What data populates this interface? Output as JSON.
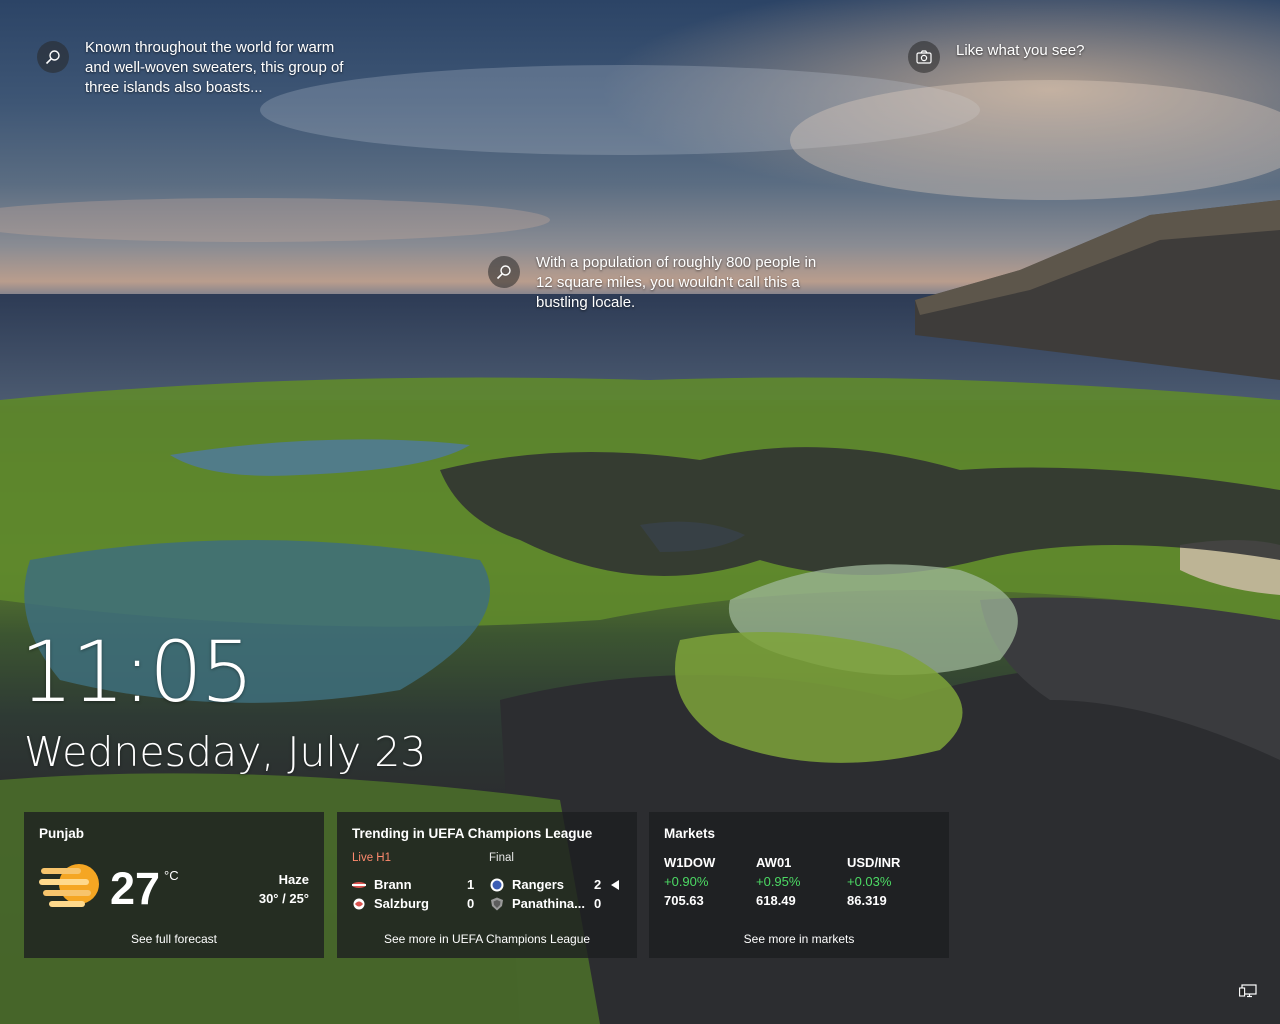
{
  "hotspots": {
    "top_left": "Known throughout the world for warm and well-woven sweaters, this group of three islands also boasts...",
    "middle": "With a population of roughly 800 people in 12 square miles, you wouldn't call this a bustling locale.",
    "top_right": "Like what you see?"
  },
  "lock": {
    "time": "11:05",
    "date": "Wednesday, July 23"
  },
  "weather": {
    "location": "Punjab",
    "temp": "27",
    "unit": "°C",
    "condition": "Haze",
    "range": "30° / 25°",
    "link": "See full forecast",
    "icon": "haze-sun-icon"
  },
  "sports": {
    "title": "Trending in UEFA Champions League",
    "match1": {
      "status": "Live H1",
      "team1": "Brann",
      "team1_score": "1",
      "team2": "Salzburg",
      "team2_score": "0"
    },
    "match2": {
      "status": "Final",
      "team1": "Rangers",
      "team1_score": "2",
      "team2": "Panathina...",
      "team2_score": "0"
    },
    "link": "See more in UEFA Champions League",
    "live_color": "#ff8a6e"
  },
  "markets": {
    "title": "Markets",
    "items": [
      {
        "symbol": "W1DOW",
        "change": "+0.90%",
        "value": "705.63"
      },
      {
        "symbol": "AW01",
        "change": "+0.95%",
        "value": "618.49"
      },
      {
        "symbol": "USD/INR",
        "change": "+0.03%",
        "value": "86.319"
      }
    ],
    "link": "See more in markets",
    "up_color": "#4cd964"
  }
}
